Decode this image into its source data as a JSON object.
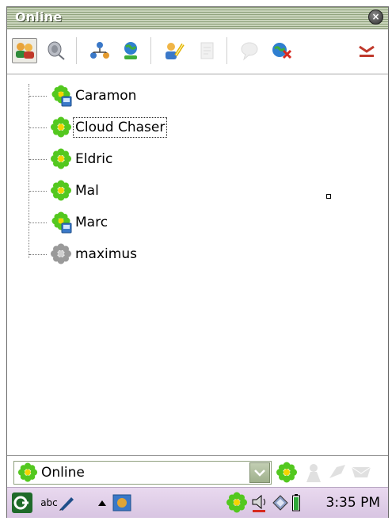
{
  "window": {
    "title": "Online",
    "close_glyph": "×"
  },
  "toolbar": {
    "buttons": [
      {
        "name": "contacts-icon",
        "pressed": true
      },
      {
        "name": "sound-icon",
        "pressed": false
      },
      {
        "name": "network-icon",
        "pressed": false
      },
      {
        "name": "globe-user-icon",
        "pressed": false
      },
      {
        "name": "user-settings-icon",
        "pressed": false
      },
      {
        "name": "notes-icon",
        "pressed": false,
        "disabled": true
      },
      {
        "name": "chat-bubble-icon",
        "pressed": false,
        "disabled": true
      },
      {
        "name": "globe-disconnect-icon",
        "pressed": false
      },
      {
        "name": "minimize-icon",
        "pressed": false
      }
    ]
  },
  "contacts": [
    {
      "name": "Caramon",
      "status": "online-mobile",
      "selected": false
    },
    {
      "name": "Cloud Chaser",
      "status": "online",
      "selected": true
    },
    {
      "name": "Eldric",
      "status": "online",
      "selected": false
    },
    {
      "name": "Mal",
      "status": "online",
      "selected": false
    },
    {
      "name": "Marc",
      "status": "online-mobile",
      "selected": false
    },
    {
      "name": "maximus",
      "status": "offline",
      "selected": false
    }
  ],
  "status_bar": {
    "current_status": "Online"
  },
  "taskbar": {
    "input_mode": "abc",
    "time": "3:35 PM"
  },
  "colors": {
    "online_green": "#53c81f",
    "flower_center": "#f5d400",
    "offline_gray": "#9a9a9a",
    "title_text": "#ffffff"
  }
}
